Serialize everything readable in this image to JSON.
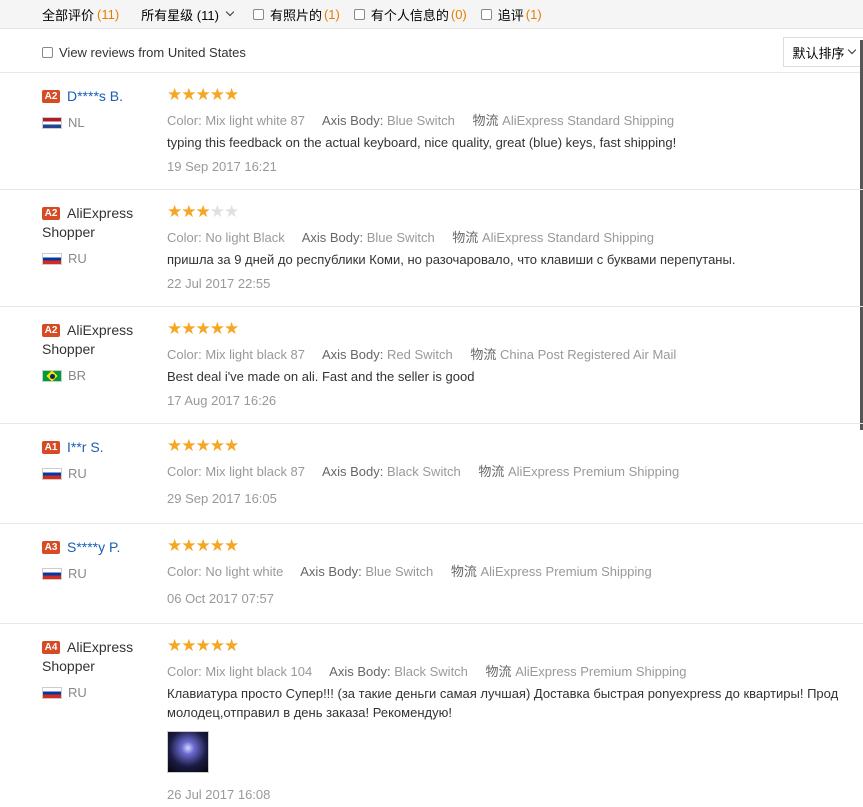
{
  "filters": {
    "all_label": "全部评价",
    "all_count": "(11)",
    "stars_label": "所有星级 (11)",
    "photos_label": "有照片的",
    "photos_count": "(1)",
    "personal_label": "有个人信息的",
    "personal_count": "(0)",
    "followup_label": "追评",
    "followup_count": "(1)",
    "country_filter": "View reviews from United States",
    "sort_label": "默认排序"
  },
  "colors": {
    "accent": "#e67e00",
    "star": "#f5a623",
    "level_badge": "#d64a24",
    "link": "#1a5fb4"
  },
  "reviews": [
    {
      "level": "A2",
      "name": "D****s B.",
      "country": "NL",
      "stars": 5,
      "color_label": "Color:",
      "color": "Mix light white 87",
      "axis_label": "Axis Body:",
      "axis": "Blue Switch",
      "ship_label": "物流",
      "ship": "AliExpress Standard Shipping",
      "text": "typing this feedback on the actual keyboard, nice quality, great (blue) keys, fast shipping!",
      "date": "19 Sep 2017 16:21"
    },
    {
      "level": "A2",
      "name": "AliExpress Shopper",
      "country": "RU",
      "stars": 3,
      "color_label": "Color:",
      "color": "No light Black",
      "axis_label": "Axis Body:",
      "axis": "Blue Switch",
      "ship_label": "物流",
      "ship": "AliExpress Standard Shipping",
      "text": "пришла за 9 дней до республики Коми, но разочаровало, что клавиши с буквами перепутаны.",
      "date": "22 Jul 2017 22:55"
    },
    {
      "level": "A2",
      "name": "AliExpress Shopper",
      "country": "BR",
      "stars": 5,
      "color_label": "Color:",
      "color": "Mix light black 87",
      "axis_label": "Axis Body:",
      "axis": "Red Switch",
      "ship_label": "物流",
      "ship": "China Post Registered Air Mail",
      "text": "Best deal i've made on ali. Fast and the seller is good",
      "date": "17 Aug 2017 16:26"
    },
    {
      "level": "A1",
      "name": "I**r S.",
      "country": "RU",
      "stars": 5,
      "color_label": "Color:",
      "color": "Mix light black 87",
      "axis_label": "Axis Body:",
      "axis": "Black Switch",
      "ship_label": "物流",
      "ship": "AliExpress Premium Shipping",
      "text": "",
      "date": "29 Sep 2017 16:05"
    },
    {
      "level": "A3",
      "name": "S****y P.",
      "country": "RU",
      "stars": 5,
      "color_label": "Color:",
      "color": "No light white",
      "axis_label": "Axis Body:",
      "axis": "Blue Switch",
      "ship_label": "物流",
      "ship": "AliExpress Premium Shipping",
      "text": "",
      "date": "06 Oct 2017 07:57"
    },
    {
      "level": "A4",
      "name": "AliExpress Shopper",
      "country": "RU",
      "stars": 5,
      "color_label": "Color:",
      "color": "Mix light black 104",
      "axis_label": "Axis Body:",
      "axis": "Black Switch",
      "ship_label": "物流",
      "ship": "AliExpress Premium Shipping",
      "text": "Клавиатура просто Супер!!! (за такие деньги самая лучшая) Доставка быстрая ponyexpress до квартиры! Прод",
      "text2": "молодец,отправил в день заказа! Рекомендую!",
      "date": "26 Jul 2017 16:08"
    }
  ]
}
